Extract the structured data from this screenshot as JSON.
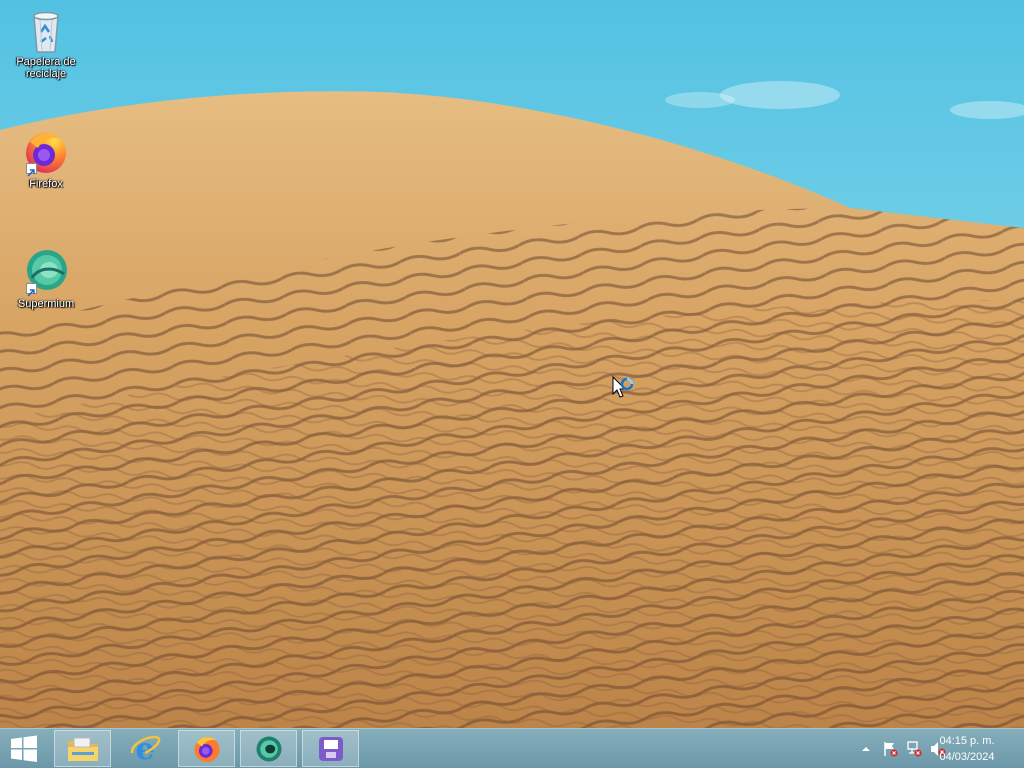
{
  "desktop": {
    "icons": [
      {
        "label": "Papelera de reciclaje",
        "icon": "recycle-bin-icon"
      },
      {
        "label": "Firefox",
        "icon": "firefox-icon"
      },
      {
        "label": "Supermium",
        "icon": "supermium-icon"
      }
    ]
  },
  "taskbar": {
    "start_icon": "windows-logo-icon",
    "pinned": [
      {
        "icon": "file-explorer-icon"
      },
      {
        "icon": "internet-explorer-icon"
      },
      {
        "icon": "firefox-icon"
      },
      {
        "icon": "supermium-icon"
      },
      {
        "icon": "floppy-disk-app-icon"
      }
    ],
    "tray": {
      "icons": [
        "show-hidden-icons-chevron",
        "action-center-flag-icon",
        "network-icon",
        "volume-muted-icon"
      ],
      "time": "04:15 p. m.",
      "date": "04/03/2024"
    }
  },
  "colors": {
    "sky": "#5fc8e3",
    "sand": "#d4a366",
    "taskbar": "#7ba6b5"
  }
}
